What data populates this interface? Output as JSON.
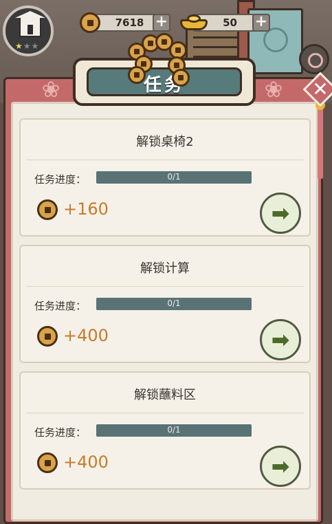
{
  "hud": {
    "coins": "7618",
    "ingots": "50",
    "plus_label": "+",
    "stars": {
      "filled": 1,
      "total": 3,
      "glyph": "★"
    }
  },
  "panel": {
    "title": "任务",
    "close_glyph": "✕",
    "flower_glyph": "❀"
  },
  "quests": [
    {
      "title": "解锁桌椅2",
      "progress_label": "任务进度：",
      "progress_text": "0/1",
      "progress": 0,
      "reward": "+160"
    },
    {
      "title": "解锁计算",
      "progress_label": "任务进度：",
      "progress_text": "0/1",
      "progress": 0,
      "reward": "+400"
    },
    {
      "title": "解锁蘸料区",
      "progress_label": "任务进度：",
      "progress_text": "0/1",
      "progress": 0,
      "reward": "+400"
    }
  ],
  "go_glyph": "➡",
  "icons": {
    "avatar": "shop-icon",
    "coin": "copper-coin-icon",
    "ingot": "gold-ingot-icon",
    "close": "close-icon",
    "go": "arrow-right-icon"
  },
  "colors": {
    "panel": "#c4696a",
    "banner": "#577a7a",
    "progress_bar": "#597275",
    "reward_text": "#c77b2a",
    "go_button": "#e8eed7"
  }
}
